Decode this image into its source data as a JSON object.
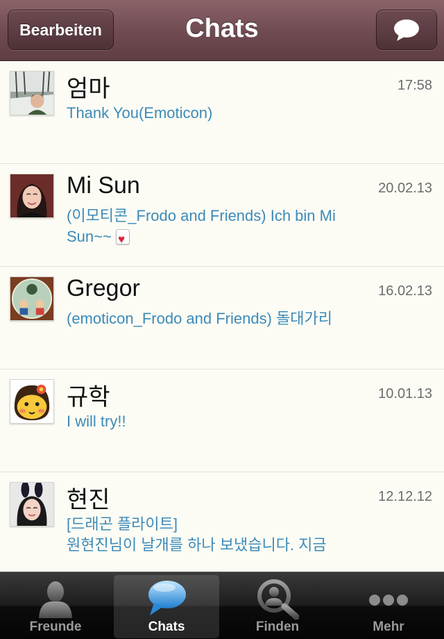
{
  "header": {
    "title": "Chats",
    "edit_label": "Bearbeiten",
    "compose_icon": "speech-bubble-icon"
  },
  "chats": [
    {
      "name": "엄마",
      "time": "17:58",
      "preview": "Thank You(Emoticon)"
    },
    {
      "name": "Mi Sun",
      "time": "20.02.13",
      "preview": "(이모티콘_Frodo and Friends) Ich bin Mi Sun~~"
    },
    {
      "name": "Gregor",
      "time": "16.02.13",
      "preview": "(emoticon_Frodo and Friends) 돌대가리"
    },
    {
      "name": "규학",
      "time": "10.01.13",
      "preview": "I will try!!"
    },
    {
      "name": "현진",
      "time": "12.12.12",
      "preview_line1": "[드래곤 플라이트]",
      "preview_line2": "원현진님이 날개를 하나 보냈습니다. 지금"
    }
  ],
  "tabbar": {
    "tabs": [
      {
        "label": "Freunde",
        "icon": "person-icon"
      },
      {
        "label": "Chats",
        "icon": "chat-bubble-icon"
      },
      {
        "label": "Finden",
        "icon": "search-person-icon"
      },
      {
        "label": "Mehr",
        "icon": "more-dots-icon"
      }
    ],
    "active": "Chats"
  },
  "colors": {
    "navbar": "#6f4a51",
    "preview_text": "#3d8ab8",
    "background": "#fcfcf5"
  }
}
